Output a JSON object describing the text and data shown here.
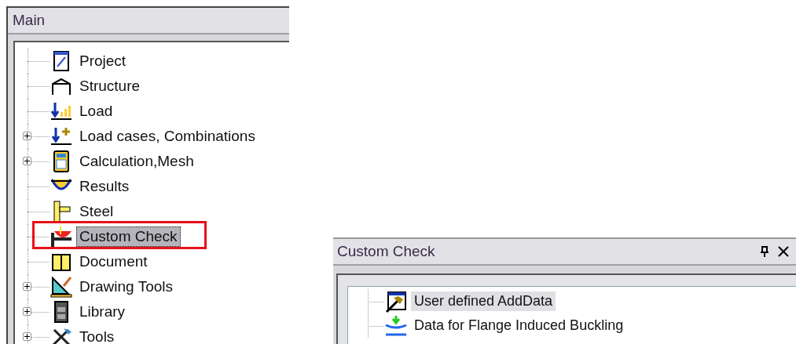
{
  "main_panel": {
    "title": "Main",
    "items": [
      {
        "label": "Project",
        "collapsed": false,
        "selected": false,
        "highlighted": false
      },
      {
        "label": "Structure",
        "collapsed": false,
        "selected": false,
        "highlighted": false
      },
      {
        "label": "Load",
        "collapsed": false,
        "selected": false,
        "highlighted": false
      },
      {
        "label": "Load cases, Combinations",
        "collapsed": true,
        "selected": false,
        "highlighted": false
      },
      {
        "label": "Calculation,Mesh",
        "collapsed": true,
        "selected": false,
        "highlighted": false
      },
      {
        "label": "Results",
        "collapsed": false,
        "selected": false,
        "highlighted": false
      },
      {
        "label": "Steel",
        "collapsed": false,
        "selected": false,
        "highlighted": false
      },
      {
        "label": "Custom Check",
        "collapsed": false,
        "selected": true,
        "highlighted": true
      },
      {
        "label": "Document",
        "collapsed": false,
        "selected": false,
        "highlighted": false
      },
      {
        "label": "Drawing Tools",
        "collapsed": true,
        "selected": false,
        "highlighted": false
      },
      {
        "label": "Library",
        "collapsed": true,
        "selected": false,
        "highlighted": false
      },
      {
        "label": "Tools",
        "collapsed": true,
        "selected": false,
        "highlighted": false
      }
    ]
  },
  "custom_check_panel": {
    "title": "Custom Check",
    "items": [
      {
        "label": "User defined AddData",
        "selected": true
      },
      {
        "label": "Data for Flange Induced Buckling",
        "selected": false
      }
    ]
  }
}
